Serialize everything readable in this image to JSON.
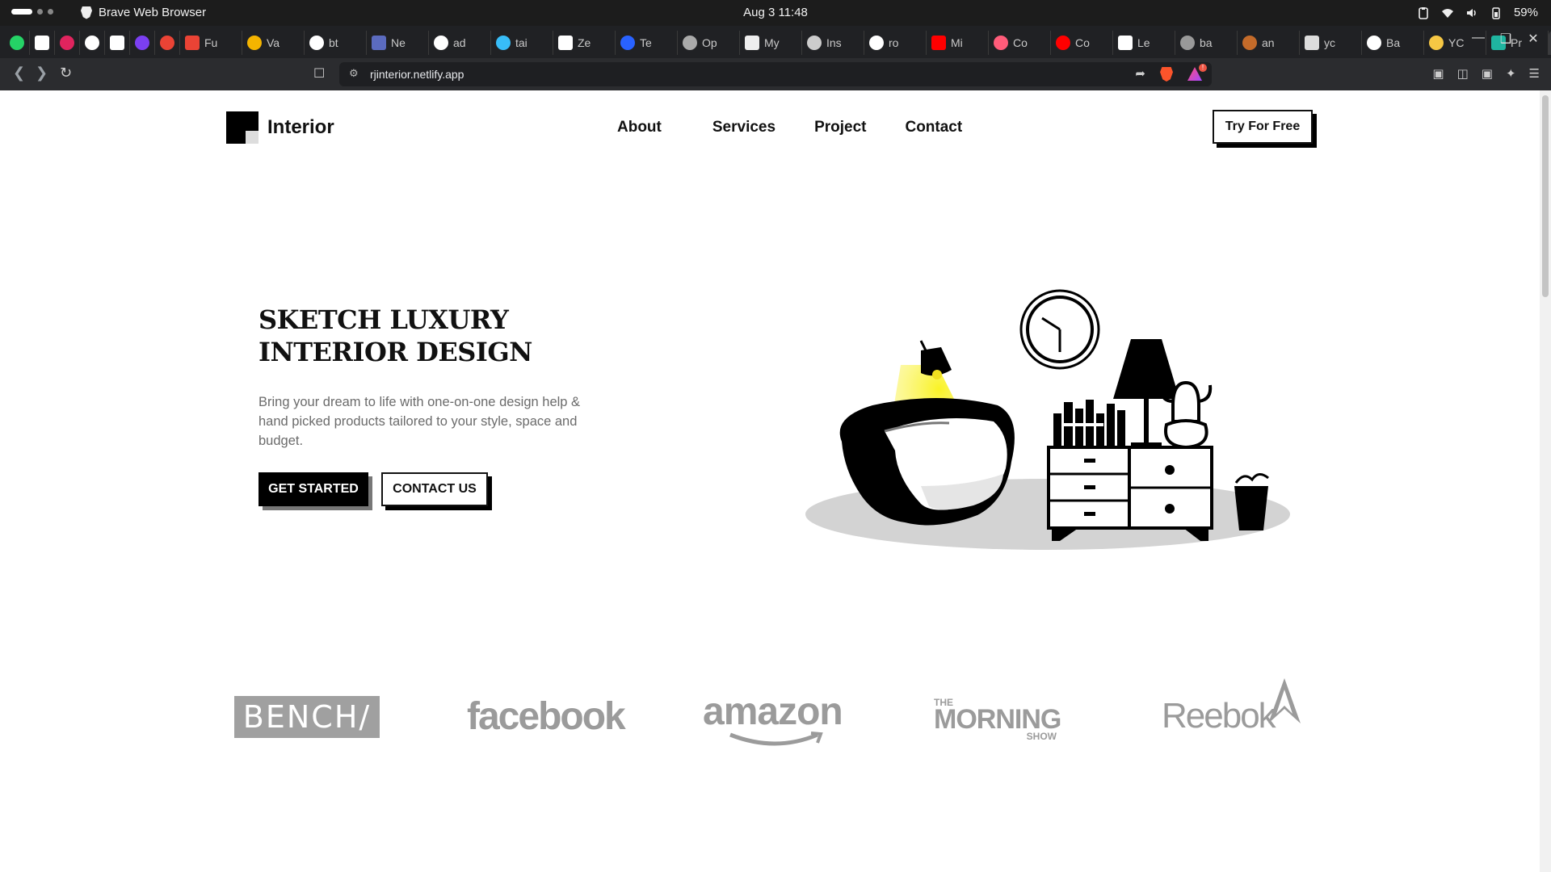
{
  "os": {
    "app_name": "Brave Web Browser",
    "clock": "Aug 3  11:48",
    "battery": "59%"
  },
  "browser": {
    "tabs": [
      {
        "label": "",
        "color": "#25d366"
      },
      {
        "label": "",
        "color": "#ffffff"
      },
      {
        "label": "",
        "color": "#e0245e"
      },
      {
        "label": "",
        "color": "#ffffff"
      },
      {
        "label": "",
        "color": "#ffffff"
      },
      {
        "label": "",
        "color": "#7b3ff2"
      },
      {
        "label": "",
        "color": "#ea4335"
      },
      {
        "label": "Fu",
        "color": "#ea4335"
      },
      {
        "label": "Va",
        "color": "#f4b400"
      },
      {
        "label": "bt",
        "color": "#ffffff"
      },
      {
        "label": "Ne",
        "color": "#5b6bbf"
      },
      {
        "label": "ad",
        "color": "#ffffff"
      },
      {
        "label": "tai",
        "color": "#38bdf8"
      },
      {
        "label": "Ze",
        "color": "#ffffff"
      },
      {
        "label": "Te",
        "color": "#2962ff"
      },
      {
        "label": "Op",
        "color": "#aaaaaa"
      },
      {
        "label": "My",
        "color": "#eeeeee"
      },
      {
        "label": "Ins",
        "color": "#cccccc"
      },
      {
        "label": "ro",
        "color": "#ffffff"
      },
      {
        "label": "Mi",
        "color": "#ff0000"
      },
      {
        "label": "Co",
        "color": "#ff5c7a"
      },
      {
        "label": "Co",
        "color": "#ff0000"
      },
      {
        "label": "Le",
        "color": "#ffffff"
      },
      {
        "label": "ba",
        "color": "#999999"
      },
      {
        "label": "an",
        "color": "#c46b2a"
      },
      {
        "label": "yc",
        "color": "#dddddd"
      },
      {
        "label": "Ba",
        "color": "#ffffff"
      },
      {
        "label": "YC",
        "color": "#f6c744"
      },
      {
        "label": "Pr",
        "color": "#1fb5a0"
      },
      {
        "label": "",
        "color": "#e7c24a"
      }
    ],
    "url": "rjinterior.netlify.app"
  },
  "site": {
    "logo_text": "Interior",
    "nav": [
      "About",
      "Services",
      "Project",
      "Contact"
    ],
    "cta": "Try For Free",
    "hero": {
      "title_line1": "SKETCH LUXURY",
      "title_line2": "INTERIOR DESIGN",
      "description": "Bring your dream to life with one-on-one design help & hand picked products tailored to your style, space and budget.",
      "primary_button": "GET STARTED",
      "secondary_button": "CONTACT US"
    },
    "brands": {
      "bench": "BENCH/",
      "facebook": "facebook",
      "amazon": "amazon",
      "morning_the": "THE",
      "morning_main": "MORNING",
      "morning_show": "SHOW",
      "reebok": "Reebok"
    }
  }
}
